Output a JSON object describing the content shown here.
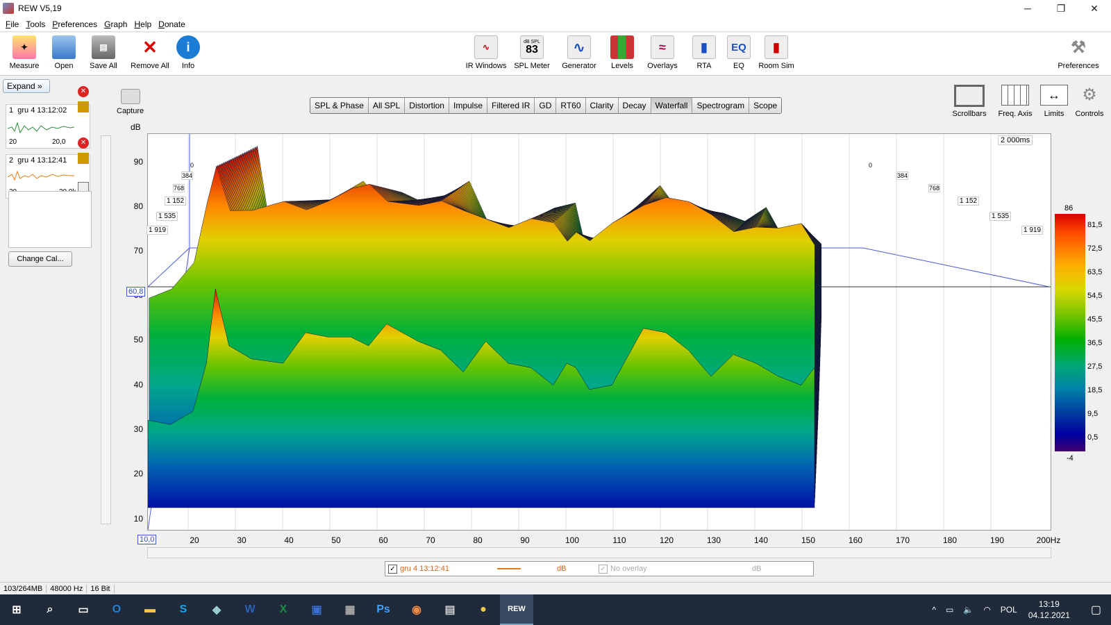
{
  "window": {
    "title": "REW V5,19",
    "minimize": "─",
    "maximize": "❐",
    "close": "✕"
  },
  "menu": [
    "File",
    "Tools",
    "Preferences",
    "Graph",
    "Help",
    "Donate"
  ],
  "toolbar_left": [
    {
      "label": "Measure",
      "icon": "measure-icon"
    },
    {
      "label": "Open",
      "icon": "open-folder-icon"
    },
    {
      "label": "Save All",
      "icon": "save-all-icon"
    },
    {
      "label": "Remove All",
      "icon": "remove-all-icon"
    },
    {
      "label": "Info",
      "icon": "info-icon"
    }
  ],
  "toolbar_center": [
    {
      "label": "IR Windows",
      "icon": "ir-windows-icon"
    },
    {
      "label": "SPL Meter",
      "icon": "spl-meter-icon",
      "readout_unit": "dB SPL",
      "readout": "83"
    },
    {
      "label": "Generator",
      "icon": "generator-icon"
    },
    {
      "label": "Levels",
      "icon": "levels-icon"
    },
    {
      "label": "Overlays",
      "icon": "overlays-icon"
    },
    {
      "label": "RTA",
      "icon": "rta-icon"
    },
    {
      "label": "EQ",
      "icon": "eq-icon",
      "glyph": "EQ"
    },
    {
      "label": "Room Sim",
      "icon": "room-sim-icon"
    }
  ],
  "toolbar_right": {
    "label": "Preferences",
    "icon": "wrench-icon"
  },
  "left_panel": {
    "expand_label": "Expand",
    "measurements": [
      {
        "index": "1",
        "name": "gru 4 13:12:02",
        "x_min": "20",
        "x_max": "20,0",
        "color": "#2e8b3a"
      },
      {
        "index": "2",
        "name": "gru 4 13:12:41",
        "x_min": "20",
        "x_max": "20,0k",
        "color": "#e87a10"
      }
    ],
    "change_cal_label": "Change Cal..."
  },
  "capture_label": "Capture",
  "graph_tabs": [
    "SPL & Phase",
    "All SPL",
    "Distortion",
    "Impulse",
    "Filtered IR",
    "GD",
    "RT60",
    "Clarity",
    "Decay",
    "Waterfall",
    "Spectrogram",
    "Scope"
  ],
  "active_tab": "Waterfall",
  "right_tools": [
    {
      "label": "Scrollbars",
      "icon": "scrollbars-icon"
    },
    {
      "label": "Freq. Axis",
      "icon": "freq-axis-icon"
    },
    {
      "label": "Limits",
      "icon": "limits-icon"
    },
    {
      "label": "Controls",
      "icon": "gear-icon"
    }
  ],
  "plot": {
    "y_unit": "dB",
    "y_ticks": [
      "90",
      "80",
      "70",
      "60",
      "50",
      "40",
      "30",
      "20",
      "10"
    ],
    "x_ticks": [
      "20",
      "30",
      "40",
      "50",
      "60",
      "70",
      "80",
      "90",
      "100",
      "110",
      "120",
      "130",
      "140",
      "150",
      "160",
      "170",
      "180",
      "190",
      "200Hz"
    ],
    "cursor_y": "60,8",
    "x_start": "10,0",
    "time_label": "2 000ms",
    "time_ticks_left": [
      "0",
      "384",
      "768",
      "1 152",
      "1 535",
      "1 919"
    ],
    "time_ticks_right": [
      "0",
      "384",
      "768",
      "1 152",
      "1 535",
      "1 919"
    ]
  },
  "colorbar": {
    "max": "86",
    "min": "-4",
    "ticks": [
      "81,5",
      "72,5",
      "63,5",
      "54,5",
      "45,5",
      "36,5",
      "27,5",
      "18,5",
      "9,5",
      "0,5"
    ]
  },
  "chart_data": {
    "type": "area",
    "title": "",
    "xlabel": "Hz",
    "ylabel": "dB",
    "xlim": [
      10,
      200
    ],
    "ylim": [
      10,
      90
    ],
    "z_axis": "ms",
    "zlim": [
      0,
      2000
    ],
    "series": [
      {
        "name": "0 ms",
        "x": [
          15,
          20,
          25,
          28,
          30,
          33,
          38,
          45,
          50,
          55,
          60,
          64,
          68,
          75,
          80,
          85,
          90,
          95,
          100,
          105,
          108,
          110,
          113,
          118,
          125,
          130,
          135,
          140,
          145,
          150,
          155,
          160,
          163
        ],
        "values": [
          58,
          60,
          66,
          80,
          88,
          78,
          78,
          80,
          78,
          80,
          83,
          84,
          80,
          79,
          80,
          78,
          76,
          74,
          76,
          75,
          71,
          73,
          71,
          75,
          79,
          81,
          80,
          77,
          73,
          74,
          74,
          75,
          70
        ]
      }
    ]
  },
  "legend": {
    "series1_name": "gru 4 13:12:41",
    "series1_unit": "dB",
    "series2_name": "No overlay",
    "series2_unit": "dB"
  },
  "status": [
    "103/264MB",
    "48000 Hz",
    "16 Bit"
  ],
  "taskbar": {
    "apps": [
      "start-icon",
      "search-icon",
      "task-view-icon",
      "outlook-icon",
      "explorer-icon",
      "skype-icon",
      "app-icon",
      "word-icon",
      "excel-icon",
      "save-icon",
      "calculator-icon",
      "photoshop-icon",
      "chrome-icon",
      "app2-icon",
      "app3-icon",
      "rew-icon"
    ],
    "time": "13:19",
    "date": "04.12.2021",
    "lang": "POL"
  }
}
